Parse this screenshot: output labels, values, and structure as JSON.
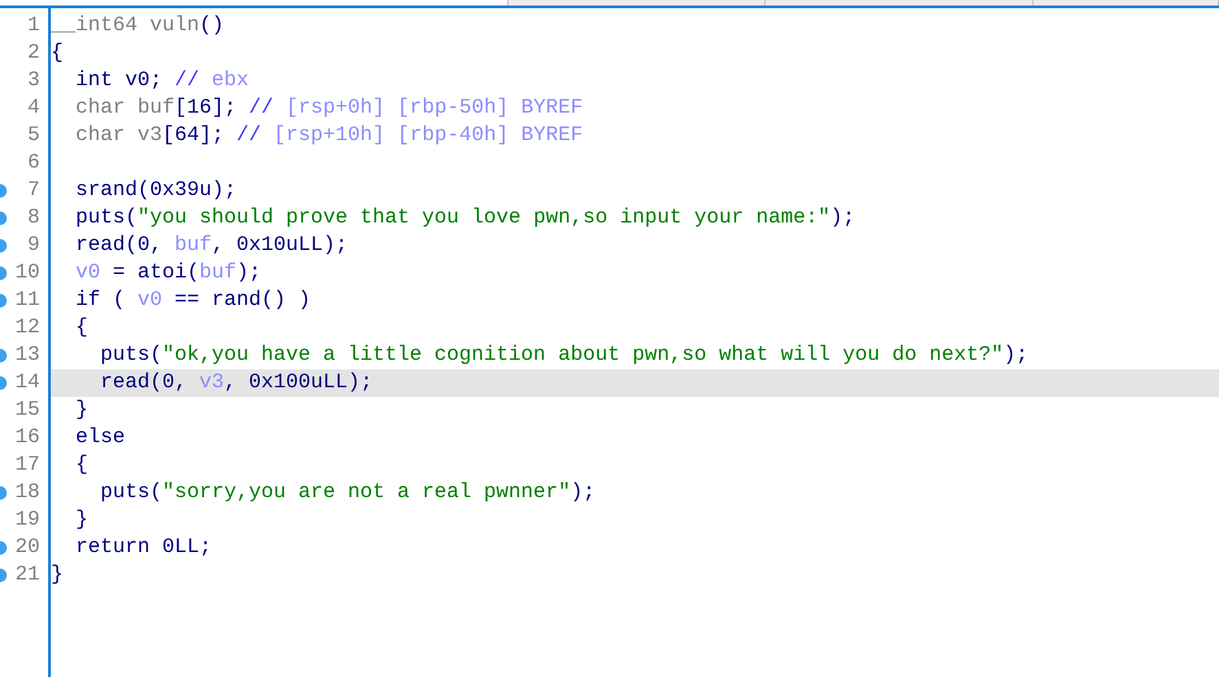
{
  "tabs": [
    {
      "selected": true
    },
    {
      "selected": false
    },
    {
      "selected": false
    },
    {
      "selected": false
    }
  ],
  "lines": [
    {
      "number": "1",
      "marked": false,
      "selected": false,
      "tokens": [
        {
          "kind": "dim",
          "text": "__int64 vuln"
        },
        {
          "kind": "code",
          "text": "()"
        }
      ]
    },
    {
      "number": "2",
      "marked": false,
      "selected": false,
      "tokens": [
        {
          "kind": "code",
          "text": "{"
        }
      ]
    },
    {
      "number": "3",
      "marked": false,
      "selected": false,
      "tokens": [
        {
          "kind": "code",
          "text": "  int v0; "
        },
        {
          "kind": "comment",
          "text": "// "
        },
        {
          "kind": "var",
          "text": "ebx"
        }
      ]
    },
    {
      "number": "4",
      "marked": false,
      "selected": false,
      "tokens": [
        {
          "kind": "dim",
          "text": "  char buf"
        },
        {
          "kind": "code",
          "text": "[16]; "
        },
        {
          "kind": "comment",
          "text": "// "
        },
        {
          "kind": "var",
          "text": "[rsp+0h] [rbp-50h] BYREF"
        }
      ]
    },
    {
      "number": "5",
      "marked": false,
      "selected": false,
      "tokens": [
        {
          "kind": "dim",
          "text": "  char v3"
        },
        {
          "kind": "code",
          "text": "[64]; "
        },
        {
          "kind": "comment",
          "text": "// "
        },
        {
          "kind": "var",
          "text": "[rsp+10h] [rbp-40h] BYREF"
        }
      ]
    },
    {
      "number": "6",
      "marked": false,
      "selected": false
    },
    {
      "number": "7",
      "marked": true,
      "selected": false,
      "tokens": [
        {
          "kind": "code",
          "text": "  srand(0x39u);"
        }
      ]
    },
    {
      "number": "8",
      "marked": true,
      "selected": false,
      "tokens": [
        {
          "kind": "code",
          "text": "  puts("
        },
        {
          "kind": "string",
          "text": "\"you should prove that you love pwn,so input your name:\""
        },
        {
          "kind": "code",
          "text": ");"
        }
      ]
    },
    {
      "number": "9",
      "marked": true,
      "selected": false,
      "tokens": [
        {
          "kind": "code",
          "text": "  read(0, "
        },
        {
          "kind": "var",
          "text": "buf"
        },
        {
          "kind": "code",
          "text": ", 0x10uLL);"
        }
      ]
    },
    {
      "number": "10",
      "marked": true,
      "selected": false,
      "tokens": [
        {
          "kind": "var",
          "text": "  v0"
        },
        {
          "kind": "code",
          "text": " = atoi("
        },
        {
          "kind": "var",
          "text": "buf"
        },
        {
          "kind": "code",
          "text": ");"
        }
      ]
    },
    {
      "number": "11",
      "marked": true,
      "selected": false,
      "tokens": [
        {
          "kind": "code",
          "text": "  if ( "
        },
        {
          "kind": "var",
          "text": "v0"
        },
        {
          "kind": "code",
          "text": " == rand() )"
        }
      ]
    },
    {
      "number": "12",
      "marked": false,
      "selected": false,
      "tokens": [
        {
          "kind": "code",
          "text": "  {"
        }
      ]
    },
    {
      "number": "13",
      "marked": true,
      "selected": false,
      "tokens": [
        {
          "kind": "code",
          "text": "    puts("
        },
        {
          "kind": "string",
          "text": "\"ok,you have a little cognition about pwn,so what will you do next?\""
        },
        {
          "kind": "code",
          "text": ");"
        }
      ]
    },
    {
      "number": "14",
      "marked": true,
      "selected": true,
      "tokens": [
        {
          "kind": "code",
          "text": "    read(0, "
        },
        {
          "kind": "var",
          "text": "v3"
        },
        {
          "kind": "code",
          "text": ", 0x100uLL);"
        }
      ]
    },
    {
      "number": "15",
      "marked": false,
      "selected": false,
      "tokens": [
        {
          "kind": "code",
          "text": "  }"
        }
      ]
    },
    {
      "number": "16",
      "marked": false,
      "selected": false,
      "tokens": [
        {
          "kind": "code",
          "text": "  else"
        }
      ]
    },
    {
      "number": "17",
      "marked": false,
      "selected": false,
      "tokens": [
        {
          "kind": "code",
          "text": "  {"
        }
      ]
    },
    {
      "number": "18",
      "marked": true,
      "selected": false,
      "tokens": [
        {
          "kind": "code",
          "text": "    puts("
        },
        {
          "kind": "string",
          "text": "\"sorry,you are not a real pwnner\""
        },
        {
          "kind": "code",
          "text": ");"
        }
      ]
    },
    {
      "number": "19",
      "marked": false,
      "selected": false,
      "tokens": [
        {
          "kind": "code",
          "text": "  }"
        }
      ]
    },
    {
      "number": "20",
      "marked": true,
      "selected": false,
      "tokens": [
        {
          "kind": "code",
          "text": "  return 0LL;"
        }
      ]
    },
    {
      "number": "21",
      "marked": true,
      "selected": false,
      "tokens": [
        {
          "kind": "code",
          "text": "}"
        }
      ]
    }
  ]
}
